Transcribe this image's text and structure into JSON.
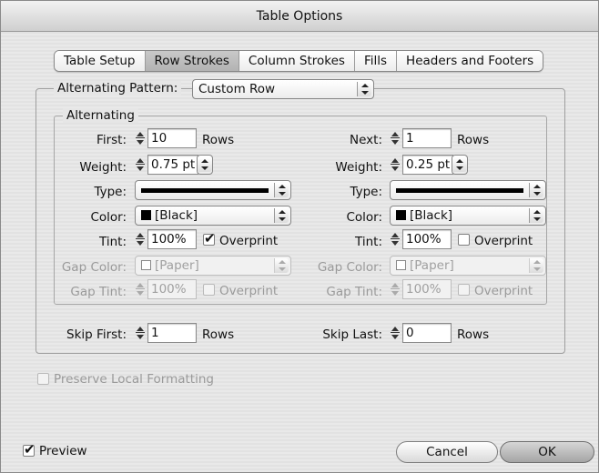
{
  "window": {
    "title": "Table Options"
  },
  "tabs": [
    {
      "label": "Table Setup",
      "active": false
    },
    {
      "label": "Row Strokes",
      "active": true
    },
    {
      "label": "Column Strokes",
      "active": false
    },
    {
      "label": "Fills",
      "active": false
    },
    {
      "label": "Headers and Footers",
      "active": false
    }
  ],
  "pattern": {
    "label": "Alternating Pattern:",
    "value": "Custom Row"
  },
  "alternating": {
    "legend": "Alternating",
    "left": {
      "count_label": "First:",
      "count_value": "10",
      "count_unit": "Rows",
      "weight_label": "Weight:",
      "weight_value": "0.75 pt",
      "type_label": "Type:",
      "color_label": "Color:",
      "color_value": "[Black]",
      "tint_label": "Tint:",
      "tint_value": "100%",
      "overprint_label": "Overprint",
      "overprint_checked": true,
      "gap_color_label": "Gap Color:",
      "gap_color_value": "[Paper]",
      "gap_tint_label": "Gap Tint:",
      "gap_tint_value": "100%",
      "gap_overprint_label": "Overprint"
    },
    "right": {
      "count_label": "Next:",
      "count_value": "1",
      "count_unit": "Rows",
      "weight_label": "Weight:",
      "weight_value": "0.25 pt",
      "type_label": "Type:",
      "color_label": "Color:",
      "color_value": "[Black]",
      "tint_label": "Tint:",
      "tint_value": "100%",
      "overprint_label": "Overprint",
      "overprint_checked": false,
      "gap_color_label": "Gap Color:",
      "gap_color_value": "[Paper]",
      "gap_tint_label": "Gap Tint:",
      "gap_tint_value": "100%",
      "gap_overprint_label": "Overprint"
    }
  },
  "skip": {
    "first_label": "Skip First:",
    "first_value": "1",
    "first_unit": "Rows",
    "last_label": "Skip Last:",
    "last_value": "0",
    "last_unit": "Rows"
  },
  "preserve_local_label": "Preserve Local Formatting",
  "preview": {
    "label": "Preview",
    "checked": true
  },
  "buttons": {
    "cancel": "Cancel",
    "ok": "OK"
  }
}
